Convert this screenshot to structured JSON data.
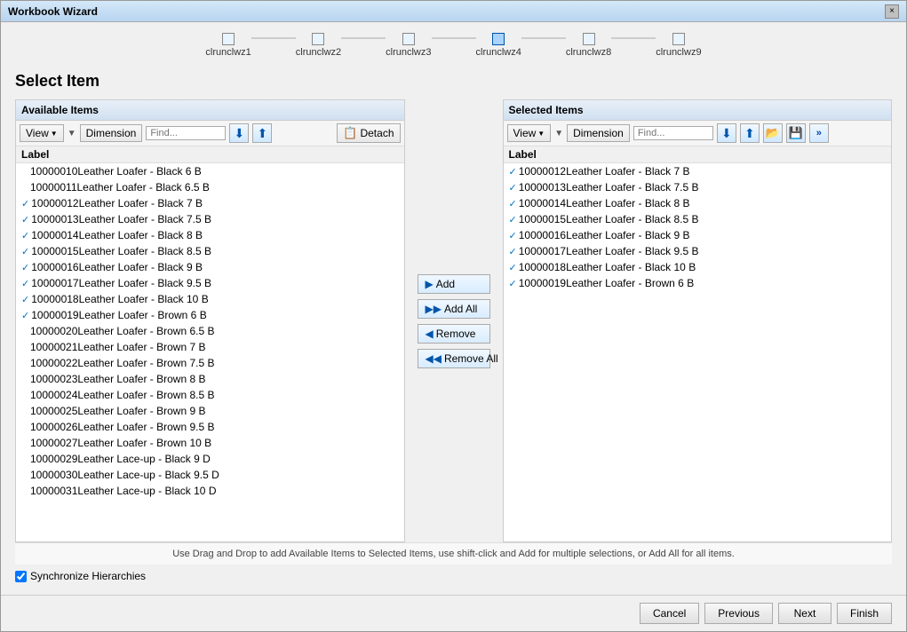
{
  "window": {
    "title": "Workbook Wizard",
    "close_label": "×"
  },
  "wizard_steps": {
    "steps": [
      {
        "label": "clrunclwz1",
        "active": false
      },
      {
        "label": "clrunclwz2",
        "active": false
      },
      {
        "label": "clrunclwz3",
        "active": false
      },
      {
        "label": "clrunclwz4",
        "active": true
      },
      {
        "label": "clrunclwz8",
        "active": false
      },
      {
        "label": "clrunclwz9",
        "active": false
      }
    ]
  },
  "page": {
    "title": "Select Item"
  },
  "available_panel": {
    "header": "Available Items",
    "toolbar": {
      "view_label": "View",
      "dimension_label": "Dimension",
      "find_placeholder": "Find...",
      "detach_label": "Detach"
    },
    "list_header": "Label",
    "items": [
      {
        "text": "10000010Leather Loafer - Black 6 B",
        "checked": false
      },
      {
        "text": "10000011Leather Loafer - Black 6.5 B",
        "checked": false
      },
      {
        "text": "10000012Leather Loafer - Black 7 B",
        "checked": true
      },
      {
        "text": "10000013Leather Loafer - Black 7.5 B",
        "checked": true
      },
      {
        "text": "10000014Leather Loafer - Black 8 B",
        "checked": true
      },
      {
        "text": "10000015Leather Loafer - Black 8.5 B",
        "checked": true
      },
      {
        "text": "10000016Leather Loafer - Black 9 B",
        "checked": true
      },
      {
        "text": "10000017Leather Loafer - Black 9.5 B",
        "checked": true
      },
      {
        "text": "10000018Leather Loafer - Black 10 B",
        "checked": true
      },
      {
        "text": "10000019Leather Loafer - Brown 6 B",
        "checked": true
      },
      {
        "text": "10000020Leather Loafer - Brown 6.5 B",
        "checked": false
      },
      {
        "text": "10000021Leather Loafer - Brown 7 B",
        "checked": false
      },
      {
        "text": "10000022Leather Loafer - Brown 7.5 B",
        "checked": false
      },
      {
        "text": "10000023Leather Loafer - Brown 8 B",
        "checked": false
      },
      {
        "text": "10000024Leather Loafer - Brown 8.5 B",
        "checked": false
      },
      {
        "text": "10000025Leather Loafer - Brown 9 B",
        "checked": false
      },
      {
        "text": "10000026Leather Loafer - Brown 9.5 B",
        "checked": false
      },
      {
        "text": "10000027Leather Loafer - Brown 10 B",
        "checked": false
      },
      {
        "text": "10000029Leather Lace-up - Black 9 D",
        "checked": false
      },
      {
        "text": "10000030Leather Lace-up - Black 9.5 D",
        "checked": false
      },
      {
        "text": "10000031Leather Lace-up - Black 10 D",
        "checked": false
      }
    ]
  },
  "middle_actions": {
    "add_label": "Add",
    "add_all_label": "Add All",
    "remove_label": "Remove",
    "remove_all_label": "Remove All"
  },
  "selected_panel": {
    "header": "Selected Items",
    "toolbar": {
      "view_label": "View",
      "dimension_label": "Dimension",
      "find_placeholder": "Find..."
    },
    "list_header": "Label",
    "items": [
      {
        "text": "10000012Leather Loafer - Black 7 B",
        "checked": true
      },
      {
        "text": "10000013Leather Loafer - Black 7.5 B",
        "checked": true
      },
      {
        "text": "10000014Leather Loafer - Black 8 B",
        "checked": true
      },
      {
        "text": "10000015Leather Loafer - Black 8.5 B",
        "checked": true
      },
      {
        "text": "10000016Leather Loafer - Black 9 B",
        "checked": true
      },
      {
        "text": "10000017Leather Loafer - Black 9.5 B",
        "checked": true
      },
      {
        "text": "10000018Leather Loafer - Black 10 B",
        "checked": true
      },
      {
        "text": "10000019Leather Loafer - Brown 6 B",
        "checked": true
      }
    ]
  },
  "bottom_info": "Use Drag and Drop to add Available Items to Selected Items, use shift-click and Add for multiple selections, or Add All for all items.",
  "sync_hierarchies": {
    "label": "Synchronize Hierarchies",
    "checked": true
  },
  "footer": {
    "cancel_label": "Cancel",
    "previous_label": "Previous",
    "next_label": "Next",
    "finish_label": "Finish"
  }
}
